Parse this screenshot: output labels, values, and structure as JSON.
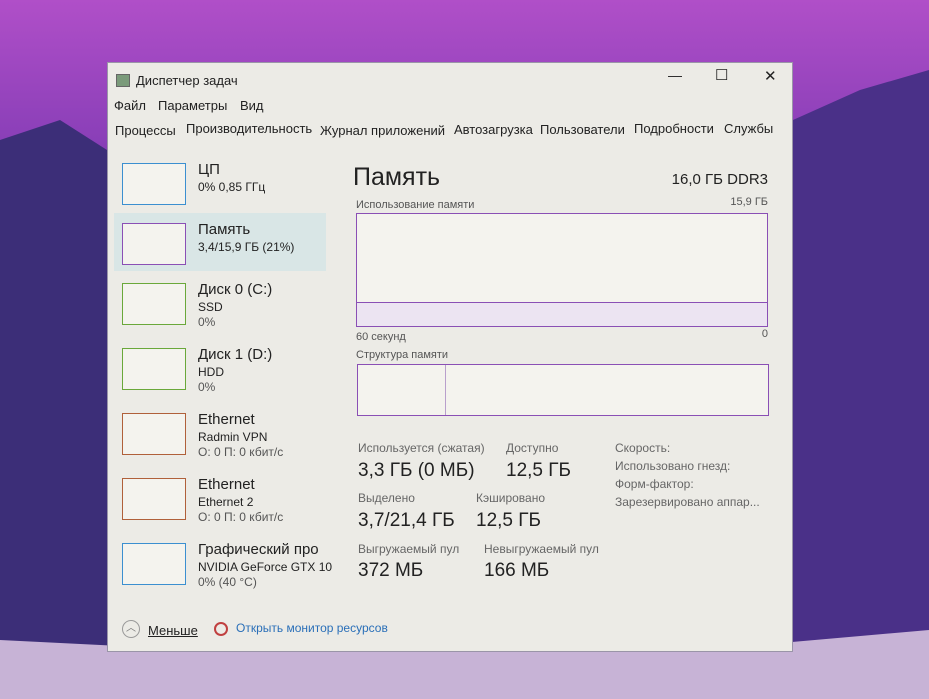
{
  "window": {
    "title": "Диспетчер задач",
    "minimize": "—",
    "maximize": "☐",
    "close": "✕"
  },
  "menu": [
    "Файл",
    "Параметры",
    "Вид"
  ],
  "tabs": [
    "Процессы",
    "Производительность",
    "Журнал приложений",
    "Автозагрузка",
    "Пользователи",
    "Подробности",
    "Службы"
  ],
  "sidebar": [
    {
      "name": "ЦП",
      "sub": "0% 0,85 ГГц",
      "sub2": "",
      "color": "#3b8fd0"
    },
    {
      "name": "Память",
      "sub": "3,4/15,9 ГБ (21%)",
      "sub2": "",
      "color": "#8a4fb5"
    },
    {
      "name": "Диск 0 (C:)",
      "sub": "SSD",
      "sub2": "0%",
      "color": "#6aa83a"
    },
    {
      "name": "Диск 1 (D:)",
      "sub": "HDD",
      "sub2": "0%",
      "color": "#6aa83a"
    },
    {
      "name": "Ethernet",
      "sub": "Radmin VPN",
      "sub2": "О: 0 П: 0 кбит/с",
      "color": "#b0603a"
    },
    {
      "name": "Ethernet",
      "sub": "Ethernet 2",
      "sub2": "О: 0 П: 0 кбит/с",
      "color": "#b0603a"
    },
    {
      "name": "Графический про",
      "sub": "NVIDIA GeForce GTX 10",
      "sub2": "0% (40 °C)",
      "color": "#3b8fd0"
    }
  ],
  "main": {
    "title": "Память",
    "spec": "16,0 ГБ DDR3",
    "usage_label": "Использование памяти",
    "usage_max": "15,9 ГБ",
    "usage_fraction": 0.21,
    "time_label": "60 секунд",
    "time_min": "0",
    "structure_label": "Структура памяти",
    "stats": [
      {
        "label": "Используется (сжатая)",
        "value": "3,3 ГБ (0 МБ)"
      },
      {
        "label": "Доступно",
        "value": "12,5 ГБ"
      },
      {
        "label": "Выделено",
        "value": "3,7/21,4 ГБ"
      },
      {
        "label": "Кэшировано",
        "value": "12,5 ГБ"
      },
      {
        "label": "Выгружаемый пул",
        "value": "372 МБ"
      },
      {
        "label": "Невыгружаемый пул",
        "value": "166 МБ"
      }
    ],
    "props": [
      "Скорость:",
      "Использовано гнезд:",
      "Форм-фактор:",
      "Зарезервировано аппар..."
    ]
  },
  "footer": {
    "less": "Меньше",
    "monitor": "Открыть монитор ресурсов"
  },
  "colors": {
    "memory": "#8a4fb5",
    "link": "#2a6fb8"
  }
}
